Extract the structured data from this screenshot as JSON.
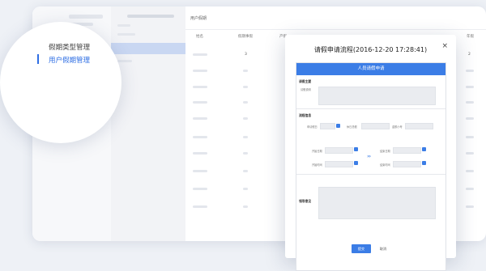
{
  "main": {
    "title": "用户假期",
    "columns": [
      "姓名",
      "假期事假",
      "产假",
      "年假"
    ],
    "row_values": [
      "3",
      "2"
    ]
  },
  "lens": {
    "items": [
      "假期类型管理",
      "用户假期管理"
    ]
  },
  "modal": {
    "title": "请假申请流程(2016-12-20 17:28:41)",
    "form_header": "人员请假申请",
    "sections": {
      "reason": "请假主要",
      "reason_field": "请假说明",
      "process": "流程信息",
      "approval": "领导意见"
    },
    "fields": {
      "leave_type": "申请假日",
      "time_start": "休日总假",
      "total": "金额小号",
      "start_date": "开始日期",
      "start_time": "开始时间",
      "end_date": "结束日期",
      "end_time": "结束时间"
    },
    "arrows": "›››",
    "submit_label": "提交",
    "cancel_label": "取消",
    "close_icon": "×"
  },
  "colors": {
    "accent": "#3b7de6",
    "lens_active": "#2f6fe4"
  }
}
